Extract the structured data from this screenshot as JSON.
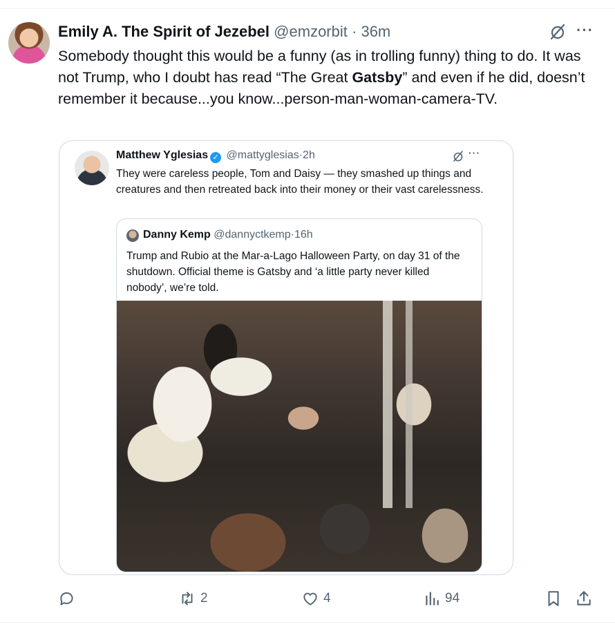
{
  "tweet": {
    "display_name": "Emily A. The Spirit of Jezebel",
    "handle": "@emzorbit",
    "separator": "·",
    "time": "36m",
    "text_before_bold": "Somebody thought this would be a funny (as in trolling funny) thing to do. It was not Trump, who I doubt has read “The Great ",
    "text_bold": "Gatsby",
    "text_after_bold": "” and even if he did, doesn’t remember it because...you know...person-man-woman-camera-TV."
  },
  "quote1": {
    "display_name": "Matthew Yglesias",
    "handle": "@mattyglesias",
    "separator": "·",
    "time": "2h",
    "verified_glyph": "✓",
    "text": "They were careless people, Tom and Daisy — they smashed up things and creatures and then retreated back into their money or their vast carelessness."
  },
  "quote2": {
    "display_name": "Danny Kemp",
    "handle": "@dannyctkemp",
    "separator": "·",
    "time": "16h",
    "text": "Trump and Rubio at the Mar-a-Lago Halloween Party, on day 31 of the shutdown. Official theme is Gatsby and ‘a little party never killed nobody’, we’re told."
  },
  "actions": {
    "reply_count": "",
    "retweet_count": "2",
    "like_count": "4",
    "views_count": "94"
  },
  "icons": {
    "edited": "edited-icon",
    "more": "more-icon",
    "reply": "reply-icon",
    "retweet": "retweet-icon",
    "like": "heart-icon",
    "views": "views-icon",
    "bookmark": "bookmark-icon",
    "share": "share-icon",
    "more_glyph": "···"
  },
  "colors": {
    "muted": "#536471",
    "verified": "#1d9bf0",
    "border": "#cfd9de"
  }
}
